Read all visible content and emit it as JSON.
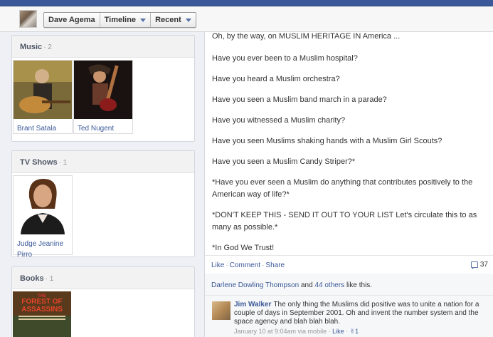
{
  "nav": {
    "profile_name": "Dave Agema",
    "timeline_label": "Timeline",
    "recent_label": "Recent"
  },
  "music": {
    "title": "Music",
    "count": "· 2",
    "items": [
      {
        "label": "Brant Satala"
      },
      {
        "label": "Ted Nugent"
      }
    ]
  },
  "tv_shows": {
    "title": "TV Shows",
    "count": "· 1",
    "items": [
      {
        "label_line1": "Judge Jeanine",
        "label_line2": "Pirro"
      }
    ]
  },
  "books": {
    "title": "Books",
    "count": "· 1",
    "items": [
      {
        "cover_line1": "THE",
        "cover_line2": "FOREST OF",
        "cover_line3": "ASSASSINS"
      }
    ]
  },
  "post": {
    "paragraphs": [
      "Oh, by the way, on MUSLIM HERITAGE IN America ...",
      "Have you ever been to a Muslim hospital?",
      "Have you heard a Muslim orchestra?",
      "Have you seen a Muslim band march in a parade?",
      "Have you witnessed a Muslim charity?",
      "Have you seen Muslims shaking hands with a Muslim Girl Scouts?",
      "Have you seen a Muslim Candy Striper?*",
      "*Have you ever seen a Muslim do anything that contributes positively to the American way of life?*",
      "*DON'T KEEP THIS - SEND IT OUT TO YOUR LIST Let's circulate this to as many as possible.*",
      "*In God We Trust!"
    ],
    "actions": {
      "like": "Like",
      "comment": "Comment",
      "share": "Share",
      "share_count": "37"
    },
    "likes": {
      "name": "Darlene Dowling Thompson",
      "and": "and",
      "others": "44 others",
      "suffix": "like this."
    },
    "comment": {
      "author": "Jim Walker",
      "text": "The only thing the Muslims did positive was to unite a nation for a couple of days in September 2001. Oh and invent the number system and the space agency and blah blah blah.",
      "time": "January 10 at 9:04am via mobile",
      "like": "Like",
      "like_count": "1"
    }
  },
  "colors": {
    "facebook_blue": "#3b5998",
    "link": "#3b5998"
  }
}
